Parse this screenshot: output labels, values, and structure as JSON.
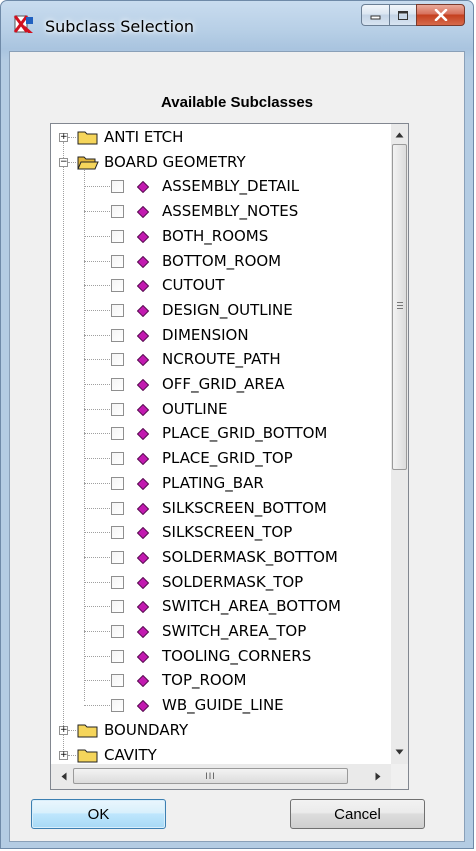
{
  "window": {
    "title": "Subclass Selection"
  },
  "heading": "Available Subclasses",
  "tree": {
    "classes_top": [
      {
        "label": "ANTI ETCH",
        "expanded": false
      },
      {
        "label": "BOARD GEOMETRY",
        "expanded": true
      }
    ],
    "subclasses": [
      "ASSEMBLY_DETAIL",
      "ASSEMBLY_NOTES",
      "BOTH_ROOMS",
      "BOTTOM_ROOM",
      "CUTOUT",
      "DESIGN_OUTLINE",
      "DIMENSION",
      "NCROUTE_PATH",
      "OFF_GRID_AREA",
      "OUTLINE",
      "PLACE_GRID_BOTTOM",
      "PLACE_GRID_TOP",
      "PLATING_BAR",
      "SILKSCREEN_BOTTOM",
      "SILKSCREEN_TOP",
      "SOLDERMASK_BOTTOM",
      "SOLDERMASK_TOP",
      "SWITCH_AREA_BOTTOM",
      "SWITCH_AREA_TOP",
      "TOOLING_CORNERS",
      "TOP_ROOM",
      "WB_GUIDE_LINE"
    ],
    "classes_bottom": [
      {
        "label": "BOUNDARY",
        "expanded": false
      },
      {
        "label": "CAVITY",
        "expanded": false
      }
    ]
  },
  "scrollbar": {
    "h_grip": "III"
  },
  "buttons": {
    "ok": "OK",
    "cancel": "Cancel"
  },
  "colors": {
    "accent_diamond": "#c21ab0",
    "folder": "#f5d55b"
  }
}
